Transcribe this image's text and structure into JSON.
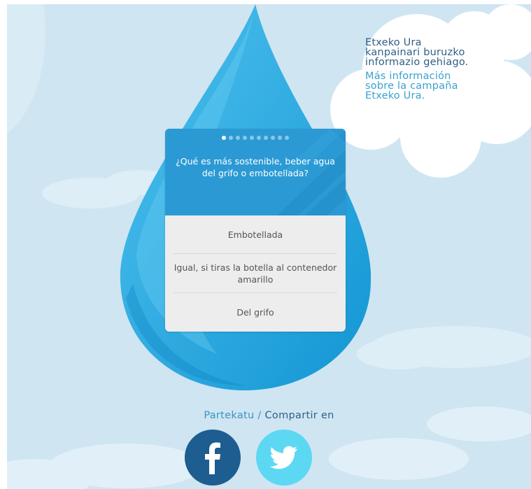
{
  "info": {
    "basque_text": "Etxeko Ura kanpainari buruzko informazio gehiago.",
    "spanish_text": "Más información sobre la campaña Etxeko Ura."
  },
  "quiz": {
    "question": "¿Qué es más sostenible, beber agua del grifo o embotellada?",
    "progress": {
      "current": 1,
      "total": 10
    },
    "answers": [
      {
        "label": "Embotellada"
      },
      {
        "label": "Igual, si tiras la botella al contenedor amarillo"
      },
      {
        "label": "Del grifo"
      }
    ]
  },
  "share": {
    "basque": "Partekatu",
    "separator": " / ",
    "spanish": "Compartir en",
    "facebook_icon": "facebook-icon",
    "twitter_icon": "twitter-icon"
  },
  "colors": {
    "sky": "#cfe5f2",
    "drop_dark": "#1a9ad6",
    "drop_light": "#3cb4e6",
    "quiz_header": "#2b9ad4",
    "answers_bg": "#ededed",
    "facebook": "#1e5d8f",
    "twitter": "#5cd8f3"
  }
}
